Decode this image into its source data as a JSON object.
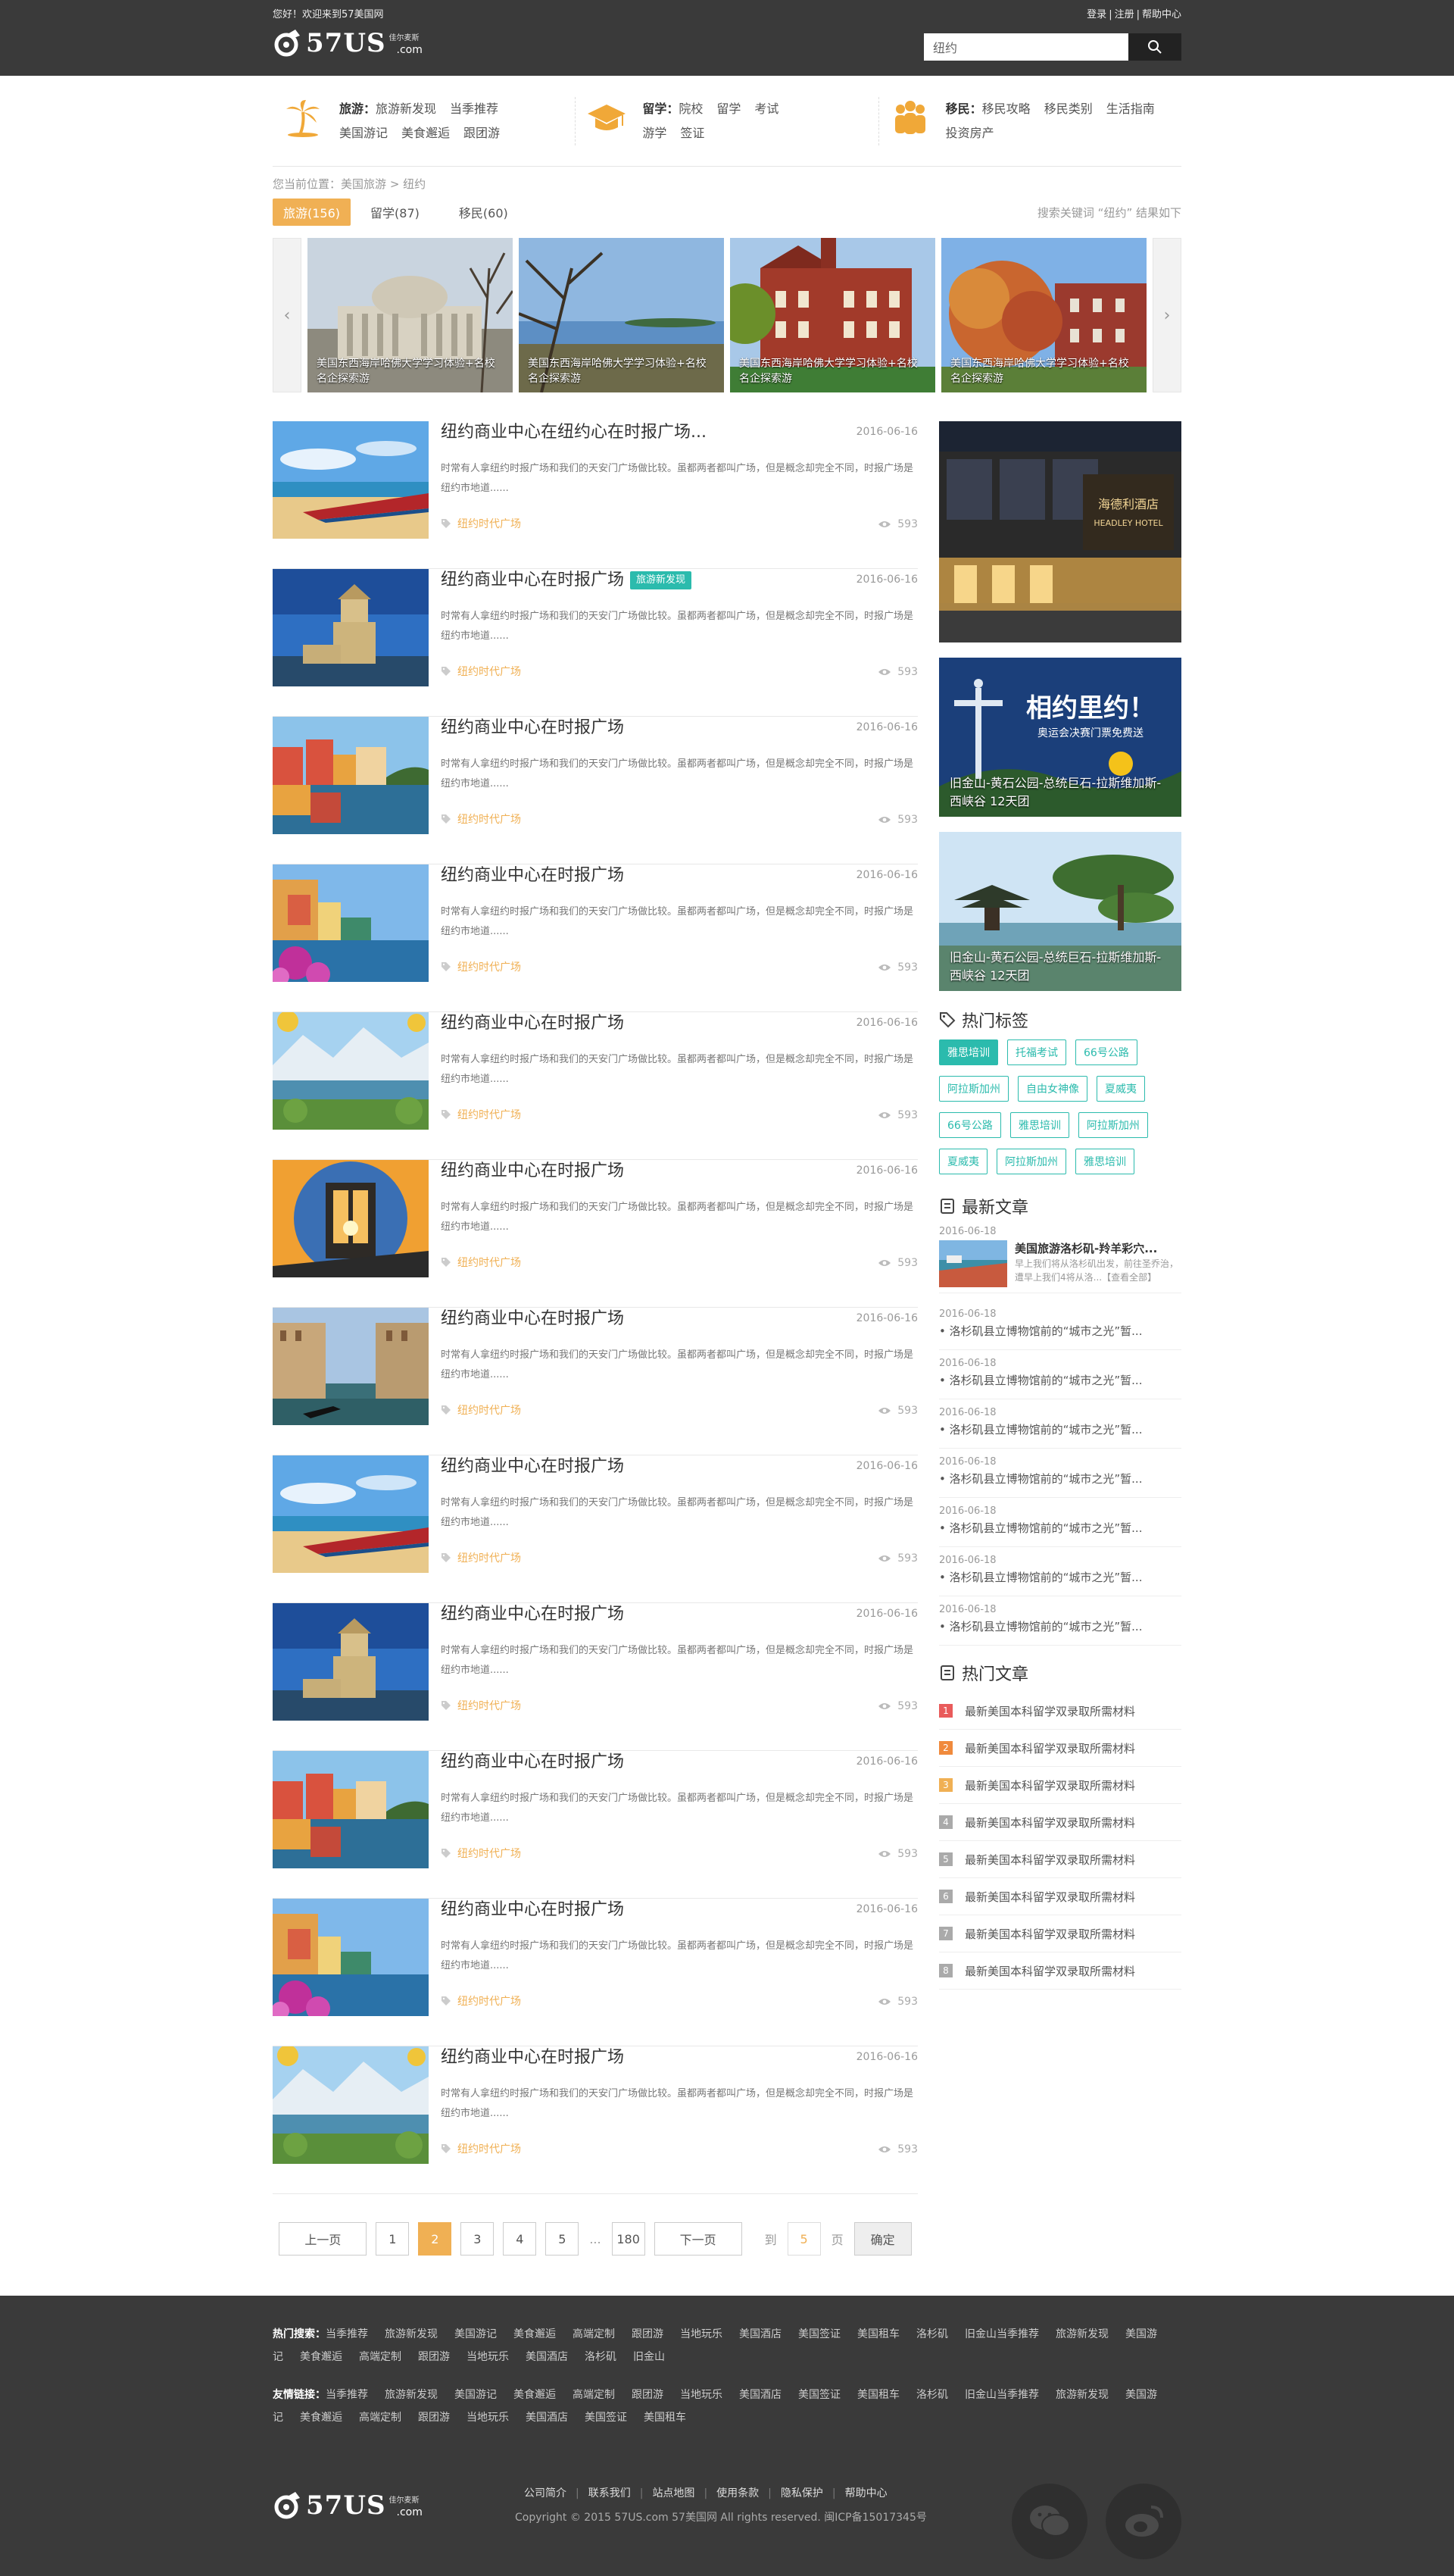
{
  "header": {
    "welcome": "您好！欢迎来到57美国网",
    "links": [
      "登录",
      "注册",
      "帮助中心"
    ],
    "logo_text": "57US",
    "logo_sub": "佳尔麦斯",
    "logo_domain": ".com",
    "search_value": "纽约"
  },
  "catnav": [
    {
      "head": "旅游：",
      "items": [
        "旅游新发现",
        "当季推荐",
        "美国游记",
        "美食邂逅",
        "跟团游"
      ]
    },
    {
      "head": "留学：",
      "items": [
        "院校",
        "留学",
        "考试",
        "游学",
        "签证"
      ]
    },
    {
      "head": "移民：",
      "items": [
        "移民攻略",
        "移民类别",
        "生活指南",
        "投资房产"
      ]
    }
  ],
  "breadcrumb": {
    "prefix": "您当前位置：",
    "path": [
      "美国旅游",
      ">",
      "纽约"
    ]
  },
  "tabs": [
    {
      "label": "旅游(156)",
      "active": true
    },
    {
      "label": "留学(87)",
      "active": false
    },
    {
      "label": "移民(60)",
      "active": false
    }
  ],
  "result_info": "搜索关键词 “纽约” 结果如下",
  "carousel": [
    {
      "caption": "美国东西海岸哈佛大学学习体验+名校名企探索游"
    },
    {
      "caption": "美国东西海岸哈佛大学学习体验+名校名企探索游"
    },
    {
      "caption": "美国东西海岸哈佛大学学习体验+名校名企探索游"
    },
    {
      "caption": "美国东西海岸哈佛大学学习体验+名校名企探索游"
    }
  ],
  "articles": [
    {
      "title": "纽约商业中心在纽约心在时报广场...",
      "badge": "",
      "date": "2016-06-16",
      "desc": "时常有人拿纽约时报广场和我们的天安门广场做比较。虽都两者都叫广场，但是概念却完全不同，时报广场是纽约市地道......",
      "tag": "纽约时代广场",
      "views": "593",
      "img": "beach"
    },
    {
      "title": "纽约商业中心在时报广场",
      "badge": "旅游新发现",
      "date": "2016-06-16",
      "desc": "时常有人拿纽约时报广场和我们的天安门广场做比较。虽都两者都叫广场，但是概念却完全不同，时报广场是纽约市地道......",
      "tag": "纽约时代广场",
      "views": "593",
      "img": "tower"
    },
    {
      "title": "纽约商业中心在时报广场",
      "badge": "",
      "date": "2016-06-16",
      "desc": "时常有人拿纽约时报广场和我们的天安门广场做比较。虽都两者都叫广场，但是概念却完全不同，时报广场是纽约市地道......",
      "tag": "纽约时代广场",
      "views": "593",
      "img": "town"
    },
    {
      "title": "纽约商业中心在时报广场",
      "badge": "",
      "date": "2016-06-16",
      "desc": "时常有人拿纽约时报广场和我们的天安门广场做比较。虽都两者都叫广场，但是概念却完全不同，时报广场是纽约市地道......",
      "tag": "纽约时代广场",
      "views": "593",
      "img": "cliff"
    },
    {
      "title": "纽约商业中心在时报广场",
      "badge": "",
      "date": "2016-06-16",
      "desc": "时常有人拿纽约时报广场和我们的天安门广场做比较。虽都两者都叫广场，但是概念却完全不同，时报广场是纽约市地道......",
      "tag": "纽约时代广场",
      "views": "593",
      "img": "lake"
    },
    {
      "title": "纽约商业中心在时报广场",
      "badge": "",
      "date": "2016-06-16",
      "desc": "时常有人拿纽约时报广场和我们的天安门广场做比较。虽都两者都叫广场，但是概念却完全不同，时报广场是纽约市地道......",
      "tag": "纽约时代广场",
      "views": "593",
      "img": "bridge"
    },
    {
      "title": "纽约商业中心在时报广场",
      "badge": "",
      "date": "2016-06-16",
      "desc": "时常有人拿纽约时报广场和我们的天安门广场做比较。虽都两者都叫广场，但是概念却完全不同，时报广场是纽约市地道......",
      "tag": "纽约时代广场",
      "views": "593",
      "img": "canal"
    },
    {
      "title": "纽约商业中心在时报广场",
      "badge": "",
      "date": "2016-06-16",
      "desc": "时常有人拿纽约时报广场和我们的天安门广场做比较。虽都两者都叫广场，但是概念却完全不同，时报广场是纽约市地道......",
      "tag": "纽约时代广场",
      "views": "593",
      "img": "beach"
    },
    {
      "title": "纽约商业中心在时报广场",
      "badge": "",
      "date": "2016-06-16",
      "desc": "时常有人拿纽约时报广场和我们的天安门广场做比较。虽都两者都叫广场，但是概念却完全不同，时报广场是纽约市地道......",
      "tag": "纽约时代广场",
      "views": "593",
      "img": "tower"
    },
    {
      "title": "纽约商业中心在时报广场",
      "badge": "",
      "date": "2016-06-16",
      "desc": "时常有人拿纽约时报广场和我们的天安门广场做比较。虽都两者都叫广场，但是概念却完全不同，时报广场是纽约市地道......",
      "tag": "纽约时代广场",
      "views": "593",
      "img": "town"
    },
    {
      "title": "纽约商业中心在时报广场",
      "badge": "",
      "date": "2016-06-16",
      "desc": "时常有人拿纽约时报广场和我们的天安门广场做比较。虽都两者都叫广场，但是概念却完全不同，时报广场是纽约市地道......",
      "tag": "纽约时代广场",
      "views": "593",
      "img": "cliff"
    },
    {
      "title": "纽约商业中心在时报广场",
      "badge": "",
      "date": "2016-06-16",
      "desc": "时常有人拿纽约时报广场和我们的天安门广场做比较。虽都两者都叫广场，但是概念却完全不同，时报广场是纽约市地道......",
      "tag": "纽约时代广场",
      "views": "593",
      "img": "lake"
    }
  ],
  "sidebar": {
    "ads": [
      {
        "caption": "",
        "sign": "海德利酒店",
        "sign_en": "HEADLEY HOTEL"
      },
      {
        "caption": "旧金山-黄石公园-总统巨石-拉斯维加斯-西峡谷 12天团",
        "headline": "相约里约！",
        "sub": "奥运会决赛门票免费送"
      },
      {
        "caption": "旧金山-黄石公园-总统巨石-拉斯维加斯-西峡谷 12天团"
      }
    ],
    "hot_tags_title": "热门标签",
    "hot_tags": [
      {
        "label": "雅思培训",
        "on": true
      },
      {
        "label": "托福考试",
        "on": false
      },
      {
        "label": "66号公路",
        "on": false
      },
      {
        "label": "阿拉斯加州",
        "on": false
      },
      {
        "label": "自由女神像",
        "on": false
      },
      {
        "label": "夏威夷",
        "on": false
      },
      {
        "label": "66号公路",
        "on": false
      },
      {
        "label": "雅思培训",
        "on": false
      },
      {
        "label": "阿拉斯加州",
        "on": false
      },
      {
        "label": "夏威夷",
        "on": false
      },
      {
        "label": "阿拉斯加州",
        "on": false
      },
      {
        "label": "雅思培训",
        "on": false
      }
    ],
    "newest_title": "最新文章",
    "newest_feature": {
      "date": "2016-06-18",
      "title": "美国旅游洛杉矶-羚羊彩穴...",
      "desc": "早上我们将从洛杉矶出发，前往圣乔治，遭早上我们4将从洛...【查看全部】"
    },
    "newest": [
      {
        "date": "2016-06-18",
        "title": "• 洛杉矶县立博物馆前的“城市之光”暂..."
      },
      {
        "date": "2016-06-18",
        "title": "• 洛杉矶县立博物馆前的“城市之光”暂..."
      },
      {
        "date": "2016-06-18",
        "title": "• 洛杉矶县立博物馆前的“城市之光”暂..."
      },
      {
        "date": "2016-06-18",
        "title": "• 洛杉矶县立博物馆前的“城市之光”暂..."
      },
      {
        "date": "2016-06-18",
        "title": "• 洛杉矶县立博物馆前的“城市之光”暂..."
      },
      {
        "date": "2016-06-18",
        "title": "• 洛杉矶县立博物馆前的“城市之光”暂..."
      },
      {
        "date": "2016-06-18",
        "title": "• 洛杉矶县立博物馆前的“城市之光”暂..."
      }
    ],
    "hot_title": "热门文章",
    "hot": [
      {
        "num": "1",
        "title": "最新美国本科留学双录取所需材料",
        "color": "#e95b5b"
      },
      {
        "num": "2",
        "title": "最新美国本科留学双录取所需材料",
        "color": "#f08a3c"
      },
      {
        "num": "3",
        "title": "最新美国本科留学双录取所需材料",
        "color": "#f0b054"
      },
      {
        "num": "4",
        "title": "最新美国本科留学双录取所需材料",
        "color": "#aaaaaa"
      },
      {
        "num": "5",
        "title": "最新美国本科留学双录取所需材料",
        "color": "#aaaaaa"
      },
      {
        "num": "6",
        "title": "最新美国本科留学双录取所需材料",
        "color": "#aaaaaa"
      },
      {
        "num": "7",
        "title": "最新美国本科留学双录取所需材料",
        "color": "#aaaaaa"
      },
      {
        "num": "8",
        "title": "最新美国本科留学双录取所需材料",
        "color": "#aaaaaa"
      }
    ]
  },
  "pager": {
    "prev": "上一页",
    "pages": [
      "1",
      "2",
      "3",
      "4",
      "5"
    ],
    "current": "2",
    "ellipsis": "...",
    "last": "180",
    "next": "下一页",
    "goto_pre": "到",
    "goto_value": "5",
    "goto_post": "页",
    "confirm": "确定"
  },
  "footer": {
    "hot_label": "热门搜索：",
    "hot_items": [
      "当季推荐",
      "旅游新发现",
      "美国游记",
      "美食邂逅",
      "高端定制",
      "跟团游",
      "当地玩乐",
      "美国酒店",
      "美国签证",
      "美国租车",
      "洛杉矶",
      "旧金山当季推荐",
      "旅游新发现",
      "美国游记",
      "美食邂逅",
      "高端定制",
      "跟团游",
      "当地玩乐",
      "美国酒店",
      "洛杉矶",
      "旧金山"
    ],
    "friend_label": "友情链接：",
    "friend_items": [
      "当季推荐",
      "旅游新发现",
      "美国游记",
      "美食邂逅",
      "高端定制",
      "跟团游",
      "当地玩乐",
      "美国酒店",
      "美国签证",
      "美国租车",
      "洛杉矶",
      "旧金山当季推荐",
      "旅游新发现",
      "美国游记",
      "美食邂逅",
      "高端定制",
      "跟团游",
      "当地玩乐",
      "美国酒店",
      "美国签证",
      "美国租车"
    ],
    "menu": [
      "公司简介",
      "联系我们",
      "站点地图",
      "使用条款",
      "隐私保护",
      "帮助中心"
    ],
    "copyright": "Copyright © 2015 57US.com 57美国网 All rights reserved. 闽ICP备15017345号"
  }
}
